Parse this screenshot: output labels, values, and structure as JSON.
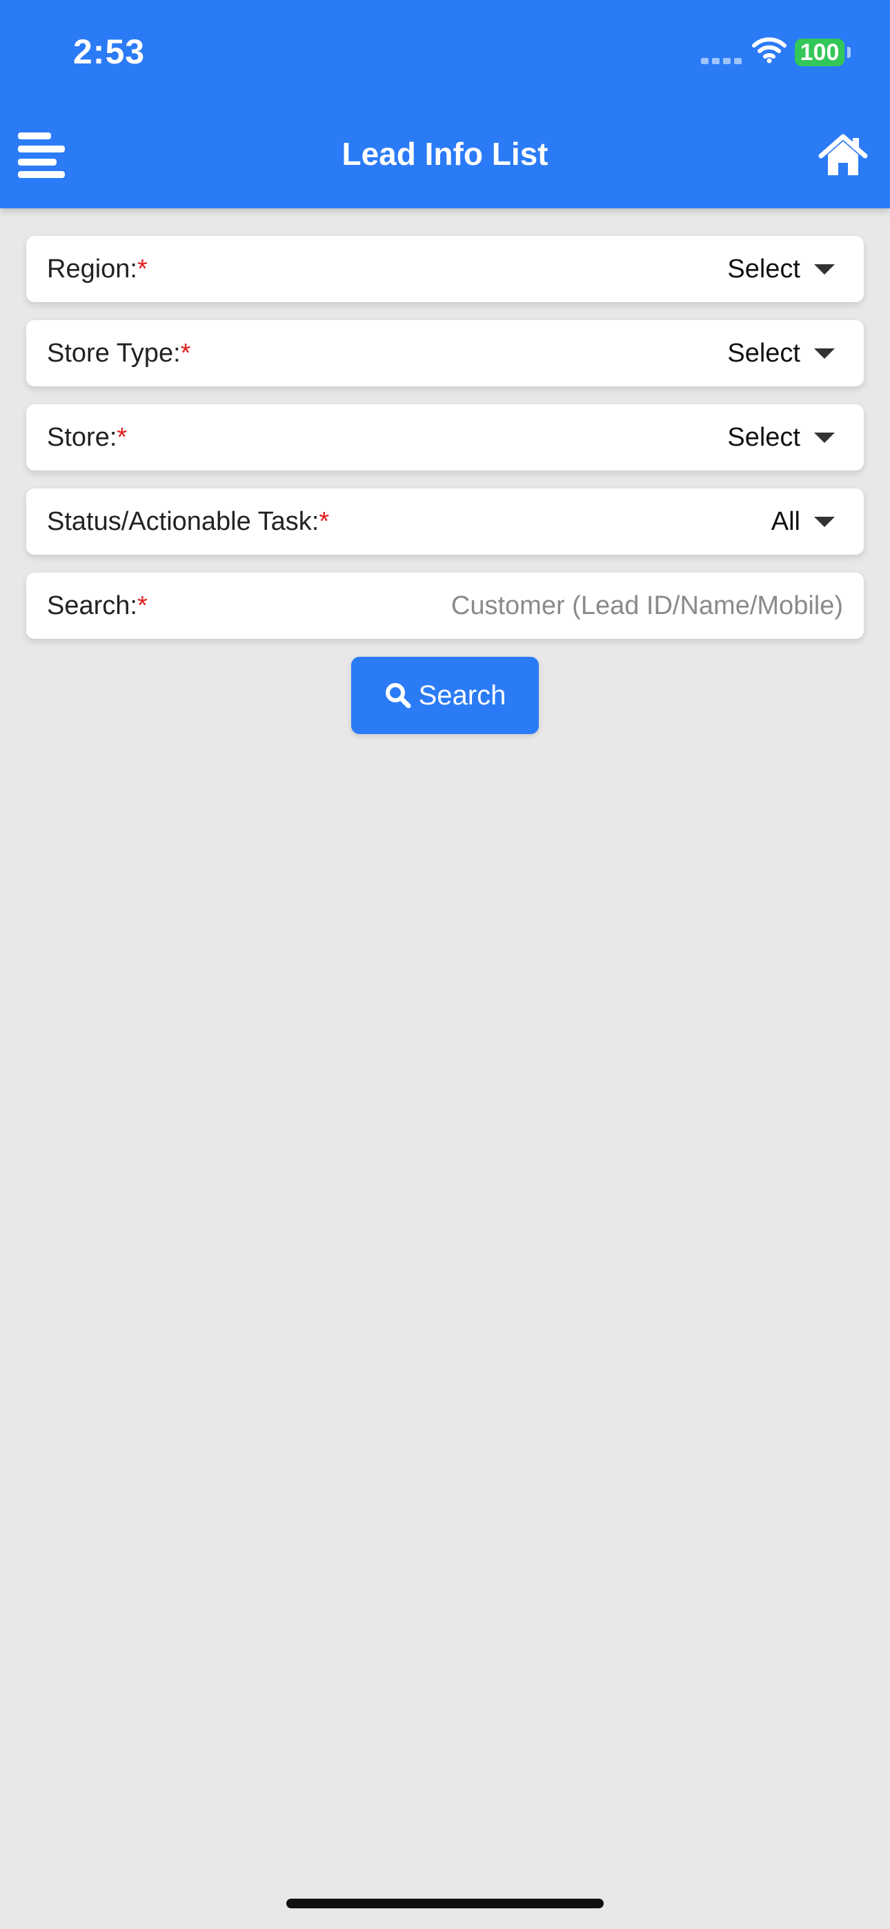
{
  "status_bar": {
    "time": "2:53",
    "battery_level": "100",
    "icons": [
      "signal-dots-icon",
      "wifi-icon",
      "battery-icon"
    ]
  },
  "nav_bar": {
    "title": "Lead Info List",
    "left_icon": "menu-icon",
    "right_icon": "home-icon"
  },
  "form": {
    "rows": [
      {
        "label": "Region:",
        "required_mark": "*",
        "value": "Select"
      },
      {
        "label": "Store Type:",
        "required_mark": "*",
        "value": "Select"
      },
      {
        "label": "Store:",
        "required_mark": "*",
        "value": "Select"
      },
      {
        "label": "Status/Actionable Task:",
        "required_mark": "*",
        "value": "All"
      }
    ],
    "search": {
      "label": "Search:",
      "required_mark": "*",
      "value": "",
      "placeholder": "Customer (Lead ID/Name/Mobile)"
    }
  },
  "search_button": {
    "label": "Search",
    "icon": "magnifier-icon"
  },
  "colors": {
    "header_bg": "#2b7bf6",
    "page_bg": "#e8e8e8",
    "required": "#e02020",
    "battery": "#33c759"
  }
}
